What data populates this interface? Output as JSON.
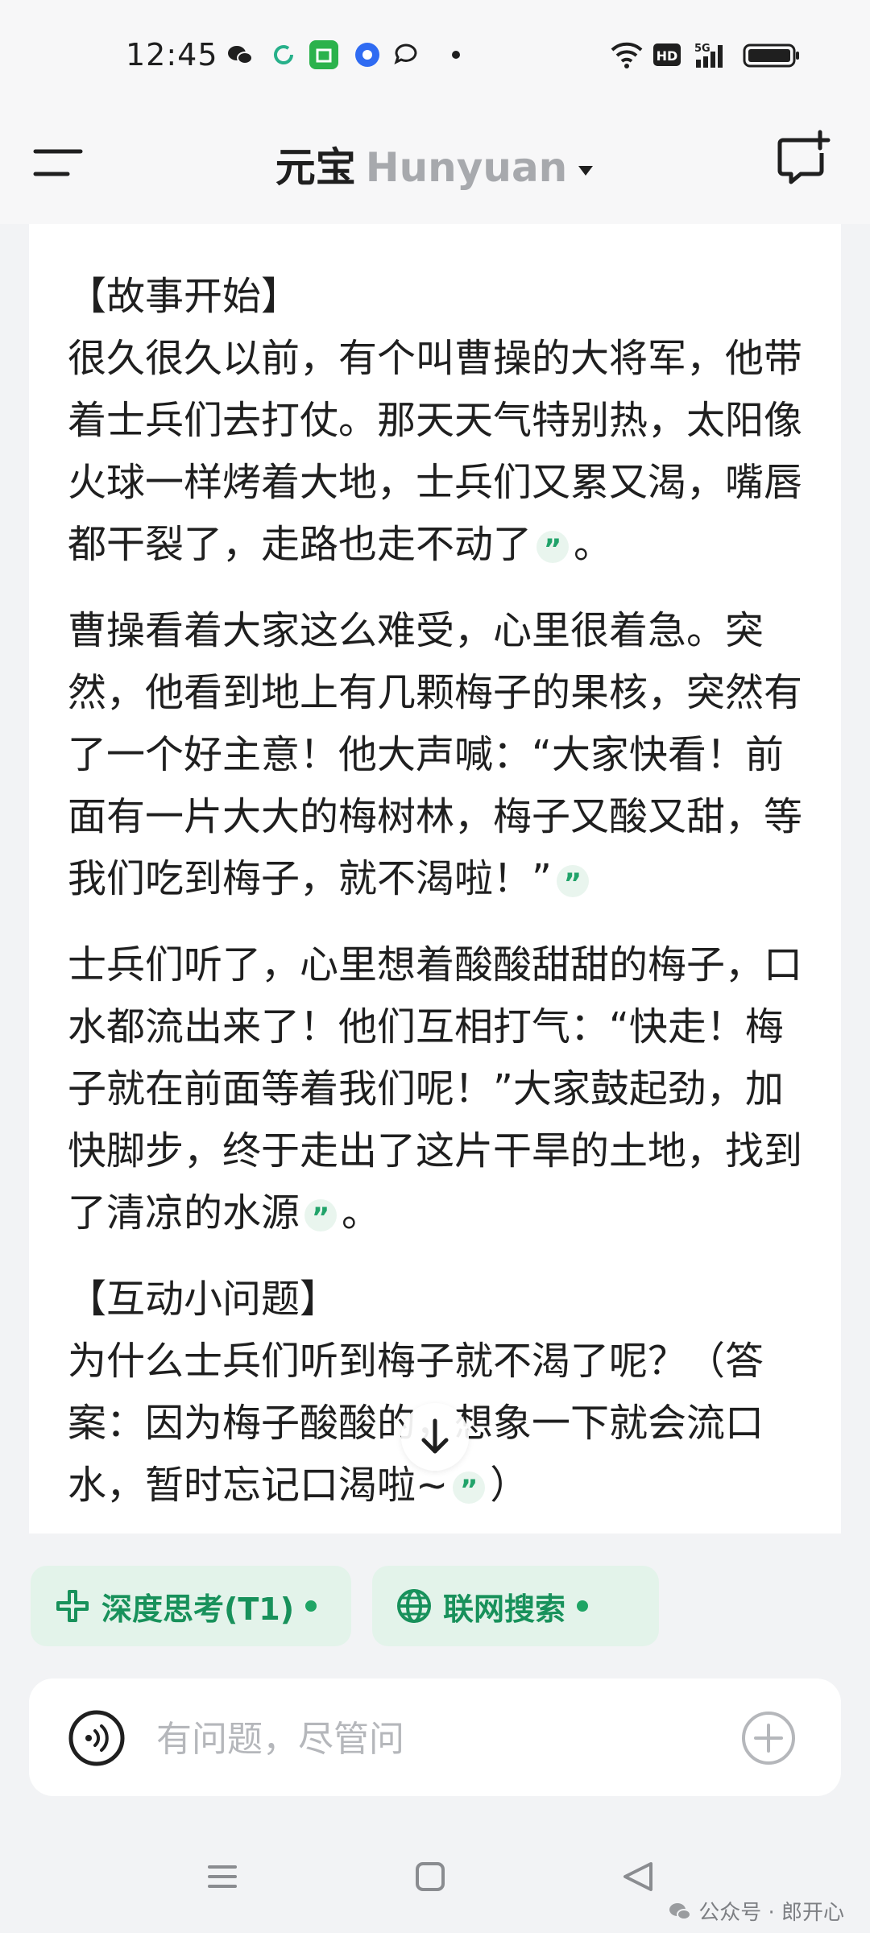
{
  "status_bar": {
    "time": "12:45"
  },
  "header": {
    "brand": "元宝",
    "model": "Hunyuan"
  },
  "story": {
    "sections": [
      {
        "heading": "【故事开始】",
        "text": "很久很久以前，有个叫曹操的大将军，他带着士兵们去打仗。那天天气特别热，太阳像火球一样烤着大地，士兵们又累又渴，嘴唇都干裂了，走路也走不动了",
        "tail": "。"
      },
      {
        "heading": "",
        "text": "曹操看着大家这么难受，心里很着急。突然，他看到地上有几颗梅子的果核，突然有了一个好主意！他大声喊：“大家快看！前面有一片大大的梅树林，梅子又酸又甜，等我们吃到梅子，就不渴啦！”",
        "tail": ""
      },
      {
        "heading": "",
        "text": "士兵们听了，心里想着酸酸甜甜的梅子，口水都流出来了！他们互相打气：“快走！梅子就在前面等着我们呢！”大家鼓起劲，加快脚步，终于走出了这片干旱的土地，找到了清凉的水源",
        "tail": "。"
      },
      {
        "heading": "【互动小问题】",
        "text": "为什么士兵们听到梅子就不渴了呢？（答案：因为梅子酸酸的，想象一下就会流口水，暂时忘记口渴啦~",
        "tail": "）"
      }
    ],
    "quote_glyph": "”"
  },
  "chips": [
    {
      "label": "深度思考(T1)",
      "icon": "deep-think-icon"
    },
    {
      "label": "联网搜索",
      "icon": "globe-icon"
    }
  ],
  "input": {
    "placeholder": "有问题，尽管问"
  },
  "watermark": {
    "text": "公众号 · 郎开心"
  },
  "colors": {
    "accent_green": "#18915b",
    "chip_bg": "#e3f3ea",
    "page_bg": "#f2f3f5"
  }
}
